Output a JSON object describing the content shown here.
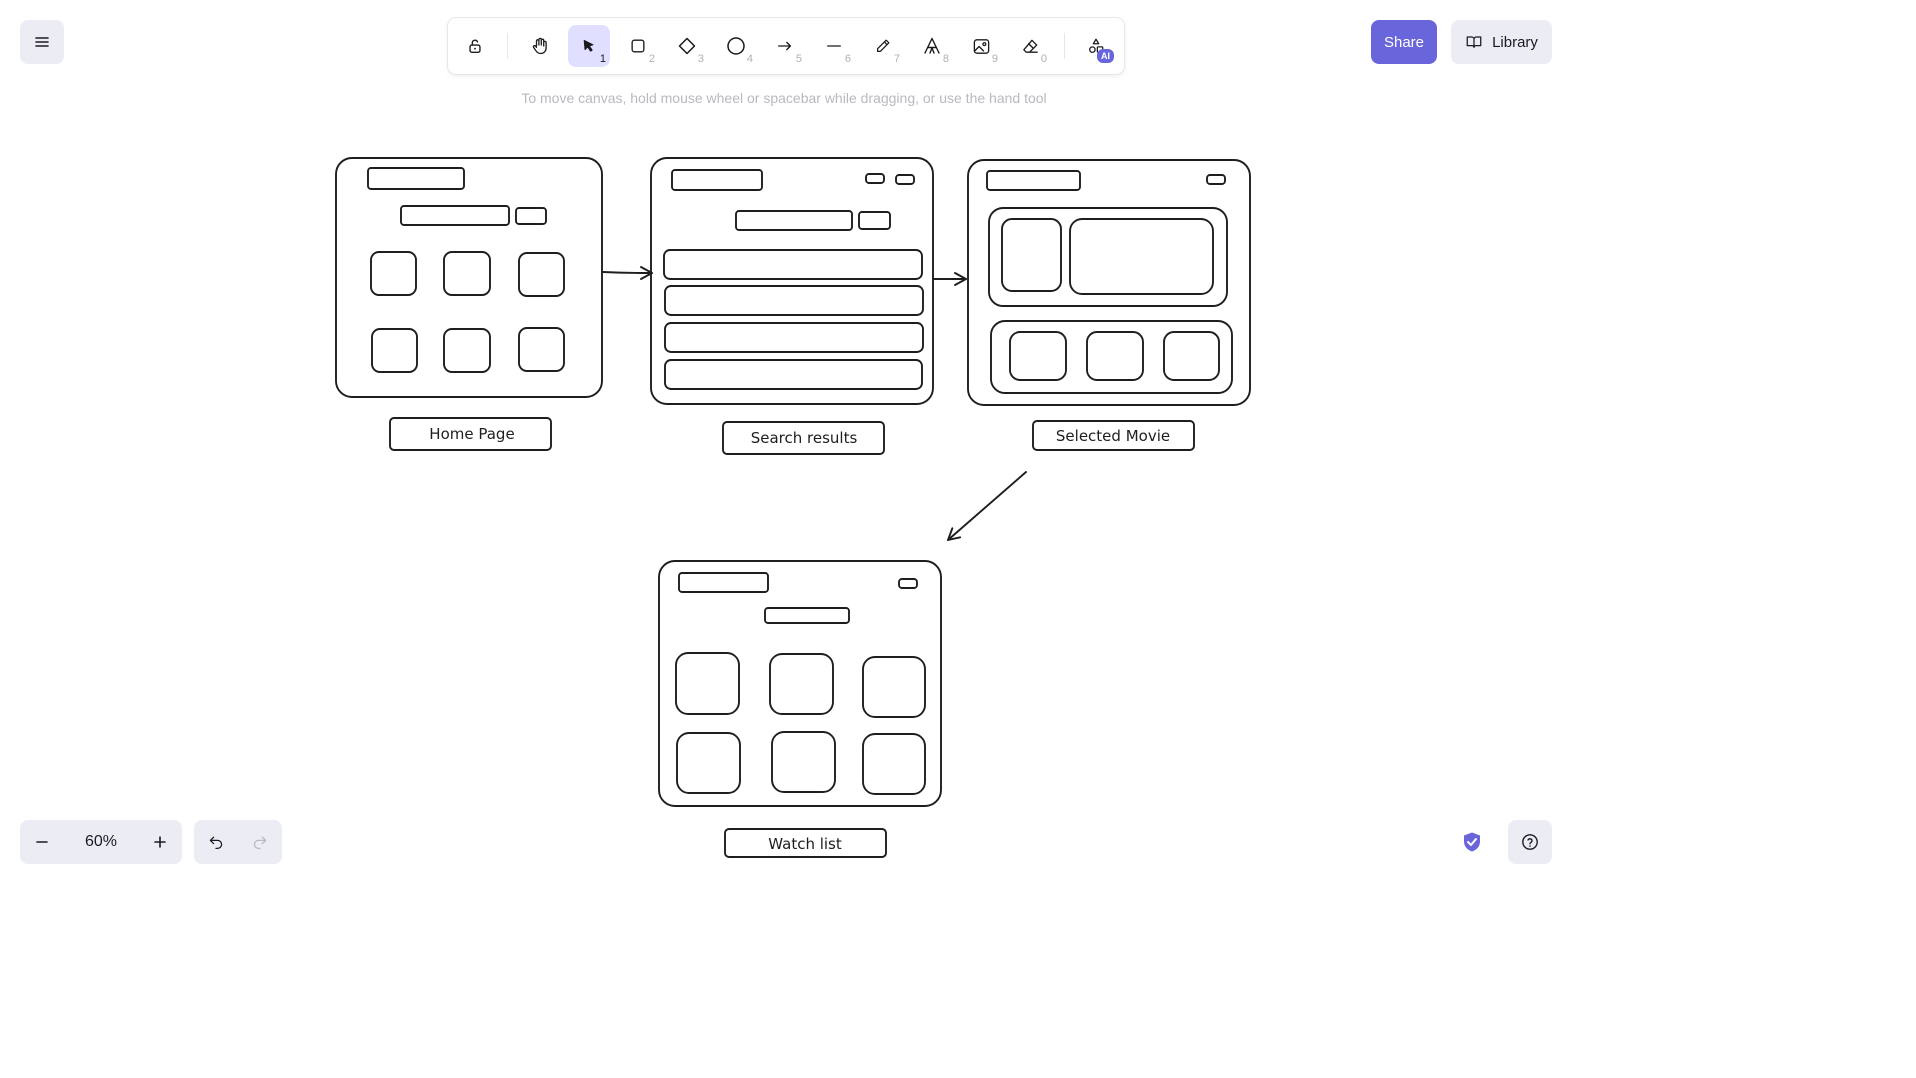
{
  "menu": {
    "icon": "hamburger-menu-icon"
  },
  "toolbar": {
    "lock": {
      "icon": "unlock-icon"
    },
    "tools": [
      {
        "name": "hand",
        "icon": "hand-icon",
        "key": ""
      },
      {
        "name": "selection",
        "icon": "pointer-arrow-icon",
        "key": "1",
        "active": true
      },
      {
        "name": "rectangle",
        "icon": "rectangle-icon",
        "key": "2"
      },
      {
        "name": "diamond",
        "icon": "diamond-icon",
        "key": "3"
      },
      {
        "name": "ellipse",
        "icon": "ellipse-icon",
        "key": "4"
      },
      {
        "name": "arrow",
        "icon": "arrow-right-icon",
        "key": "5"
      },
      {
        "name": "line",
        "icon": "line-icon",
        "key": "6"
      },
      {
        "name": "draw",
        "icon": "pencil-icon",
        "key": "7"
      },
      {
        "name": "text",
        "icon": "text-icon",
        "key": "8"
      },
      {
        "name": "image",
        "icon": "image-icon",
        "key": "9"
      },
      {
        "name": "eraser",
        "icon": "eraser-icon",
        "key": "0"
      }
    ],
    "more_tools": {
      "icon": "shapes-icon",
      "badge": "AI"
    }
  },
  "share": {
    "label": "Share"
  },
  "library": {
    "label": "Library",
    "icon": "book-open-icon"
  },
  "hint": "To move canvas, hold mouse wheel or spacebar while dragging, or use the hand tool",
  "canvas": {
    "captions": {
      "home": "Home Page",
      "search": "Search results",
      "selected": "Selected Movie",
      "watchlist": "Watch list"
    }
  },
  "zoom": {
    "level": "60%",
    "out_icon": "minus-icon",
    "in_icon": "plus-icon"
  },
  "history": {
    "undo_icon": "undo-icon",
    "redo_icon": "redo-icon"
  },
  "status": {
    "shield_icon": "shield-check-icon",
    "help_icon": "help-circle-icon"
  },
  "colors": {
    "accent": "#6965db",
    "active_tool_bg": "#e0dfff",
    "ui_bg": "#ececf4",
    "stroke": "#1e1e1e"
  }
}
